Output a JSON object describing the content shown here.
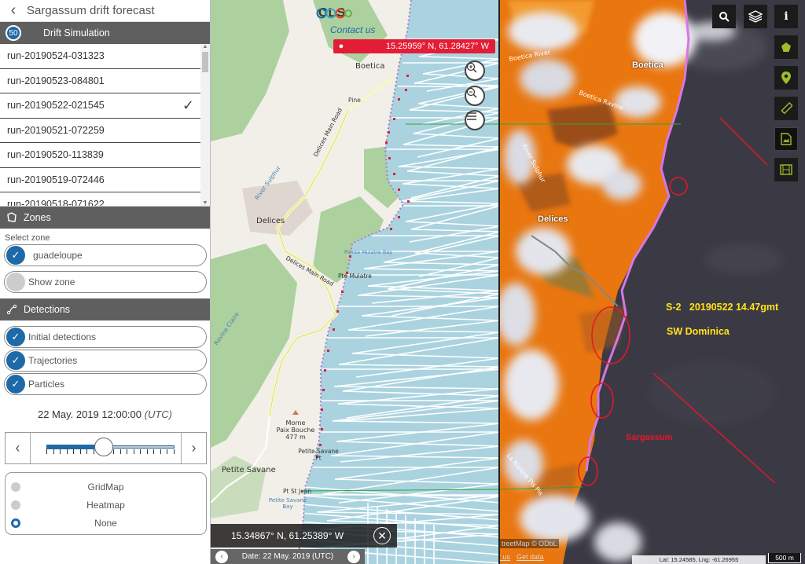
{
  "sidebar": {
    "title": "Sargassum drift forecast",
    "drift_badge": "50",
    "drift_title": "Drift Simulation",
    "runs": [
      {
        "label": "run-20190524-031323",
        "selected": false
      },
      {
        "label": "run-20190523-084801",
        "selected": false
      },
      {
        "label": "run-20190522-021545",
        "selected": true
      },
      {
        "label": "run-20190521-072259",
        "selected": false
      },
      {
        "label": "run-20190520-113839",
        "selected": false
      },
      {
        "label": "run-20190519-072446",
        "selected": false
      },
      {
        "label": "run-20190518-071622",
        "selected": false
      }
    ],
    "zones_title": "Zones",
    "select_zone_label": "Select zone",
    "zone_value": "guadeloupe",
    "show_zone_label": "Show zone",
    "detections_title": "Detections",
    "detections": {
      "initial": "Initial detections",
      "trajectories": "Trajectories",
      "particles": "Particles"
    },
    "datetime": "22 May. 2019 12:00:00",
    "timezone": "(UTC)",
    "slider_position": 0.45,
    "layers": {
      "gridmap": "GridMap",
      "heatmap": "Heatmap",
      "none": "None",
      "selected": "None"
    }
  },
  "map": {
    "logo_text": "CLS",
    "contact_label": "Contact us",
    "coord_top": "15.25959° N, 61.28427° W",
    "coord_bottom": "15.34867° N, 61.25389° W",
    "date_bar": "Date: 22 May. 2019 (UTC)",
    "labels": {
      "boetica": "Boetica",
      "delices_main_road": "Delices Main Road",
      "delices_main_road_2": "Delices Main Road",
      "delices": "Delices",
      "river_sulphur": "River Sulphur",
      "pointe_mulatre_bay": "Pointe Mulatre Bay",
      "pte_mulatre": "Pte Mulatre",
      "morne": "Morne\nPaix Bouche\n477 m",
      "petite_savane_pt": "Petite Savane\nPt",
      "petite_savane": "Petite Savane",
      "pt_st_jean": "Pt St Jean",
      "petite_savane_bay": "Petite Savane\nBay",
      "ravine_claire": "Ravine Claire",
      "pine": "Pine"
    },
    "colors": {
      "water": "#aad3df",
      "land": "#f2efe9",
      "forest": "#add19e",
      "road": "#f7fabf",
      "trajectory": "#ffffff",
      "detection": "#e41d37"
    }
  },
  "satellite": {
    "labels": {
      "boetica": "Boetica",
      "delices": "Delices",
      "boetica_river": "Boetica River",
      "boetica_ravine": "Boetica Ravine",
      "river_sulphur": "River Sulphur",
      "la_riviere": "La Riviere Pis Pis"
    },
    "annotation_line1": "S-2   20190522 14.47gmt",
    "annotation_line2": "SW Dominica",
    "sargassum_label": "Sargassum",
    "attribution": "treetMap © ODbL",
    "link_contact": "ct us",
    "link_getdata": "Get data",
    "latlng": "Lat: 15.24585, Lng: -61.26955",
    "scale": "500 m",
    "tools": [
      "search-icon",
      "layers-icon",
      "info-icon",
      "pentagon-icon",
      "map-pin-icon",
      "ruler-icon",
      "image-file-icon",
      "film-icon"
    ]
  }
}
